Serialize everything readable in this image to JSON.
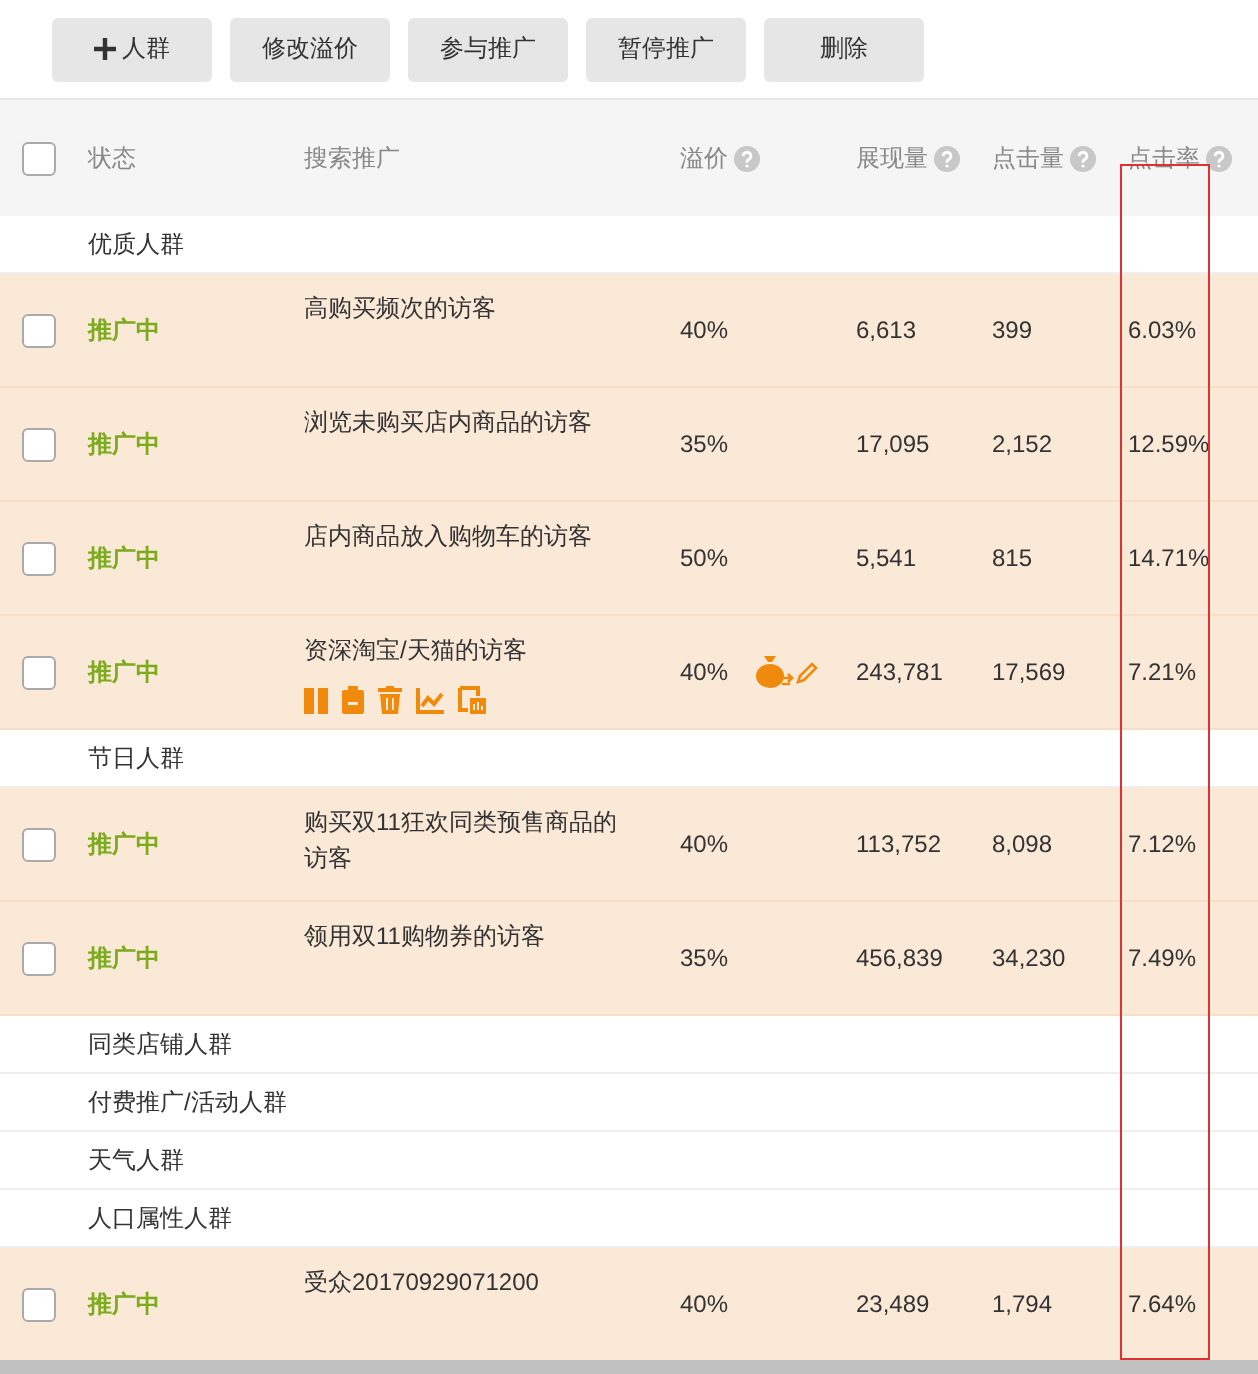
{
  "toolbar": {
    "buttons": [
      {
        "kind": "add",
        "label": "人群"
      },
      {
        "kind": "plain",
        "label": "修改溢价"
      },
      {
        "kind": "plain",
        "label": "参与推广"
      },
      {
        "kind": "plain",
        "label": "暂停推广"
      },
      {
        "kind": "plain",
        "label": "删除"
      }
    ]
  },
  "table": {
    "select_all_checked": false,
    "columns": [
      {
        "kind": "plain",
        "label": "状态",
        "highlighted": false
      },
      {
        "kind": "plain",
        "label": "搜索推广",
        "highlighted": false
      },
      {
        "kind": "help",
        "label": "溢价",
        "highlighted": false
      },
      {
        "kind": "help",
        "label": "展现量",
        "highlighted": false
      },
      {
        "kind": "help",
        "label": "点击量",
        "highlighted": false
      },
      {
        "kind": "help",
        "label": "点击率",
        "highlighted": true
      }
    ],
    "groups": [
      {
        "name": "优质人群",
        "rows": [
          {
            "kind": "plain",
            "checked": false,
            "status": "推广中",
            "name": "高购买频次的访客",
            "premium": "40%",
            "impressions": "6,613",
            "clicks": "399",
            "ctr": "6.03%"
          },
          {
            "kind": "plain",
            "checked": false,
            "status": "推广中",
            "name": "浏览未购买店内商品的访客",
            "premium": "35%",
            "impressions": "17,095",
            "clicks": "2,152",
            "ctr": "12.59%"
          },
          {
            "kind": "plain",
            "checked": false,
            "status": "推广中",
            "name": "店内商品放入购物车的访客",
            "premium": "50%",
            "impressions": "5,541",
            "clicks": "815",
            "ctr": "14.71%"
          },
          {
            "kind": "hovered",
            "checked": false,
            "status": "推广中",
            "name": "资深淘宝/天猫的访客",
            "premium": "40%",
            "impressions": "243,781",
            "clicks": "17,569",
            "ctr": "7.21%"
          }
        ]
      },
      {
        "name": "节日人群",
        "rows": [
          {
            "kind": "plain",
            "checked": false,
            "status": "推广中",
            "name": "购买双11狂欢同类预售商品的访客",
            "premium": "40%",
            "impressions": "113,752",
            "clicks": "8,098",
            "ctr": "7.12%"
          },
          {
            "kind": "plain",
            "checked": false,
            "status": "推广中",
            "name": "领用双11购物券的访客",
            "premium": "35%",
            "impressions": "456,839",
            "clicks": "34,230",
            "ctr": "7.49%"
          }
        ]
      },
      {
        "name": "同类店铺人群"
      },
      {
        "name": "付费推广/活动人群"
      },
      {
        "name": "天气人群"
      },
      {
        "name": "人口属性人群",
        "rows": [
          {
            "kind": "plain",
            "checked": false,
            "status": "推广中",
            "name": "受众20170929071200",
            "premium": "40%",
            "impressions": "23,489",
            "clicks": "1,794",
            "ctr": "7.64%"
          }
        ]
      }
    ]
  }
}
